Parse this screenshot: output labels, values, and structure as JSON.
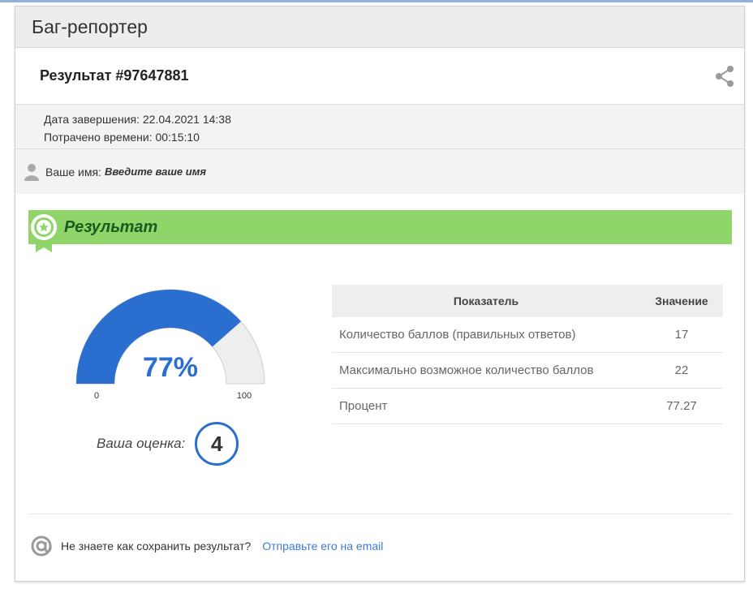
{
  "app": {
    "title": "Баг-репортер"
  },
  "result": {
    "title": "Результат #97647881"
  },
  "meta": {
    "completion_label": "Дата завершения:",
    "completion_value": "22.04.2021 14:38",
    "time_label": "Потрачено времени:",
    "time_value": "00:15:10"
  },
  "user": {
    "label": "Ваше имя:",
    "placeholder": "Введите ваше имя"
  },
  "section": {
    "title": "Результат"
  },
  "gauge": {
    "percent_text": "77%",
    "percent": 77,
    "min": "0",
    "max": "100",
    "fill_color": "#2a6fd0"
  },
  "grade": {
    "label": "Ваша оценка:",
    "value": "4"
  },
  "table": {
    "headers": [
      "Показатель",
      "Значение"
    ],
    "rows": [
      {
        "name": "Количество баллов (правильных ответов)",
        "value": "17"
      },
      {
        "name": "Максимально возможное количество баллов",
        "value": "22"
      },
      {
        "name": "Процент",
        "value": "77.27"
      }
    ]
  },
  "footer": {
    "question": "Не знаете как сохранить результат?",
    "link": "Отправьте его на email"
  },
  "colors": {
    "banner": "#8fd56a",
    "accent": "#2a6fd0",
    "link": "#3d7bd6"
  }
}
